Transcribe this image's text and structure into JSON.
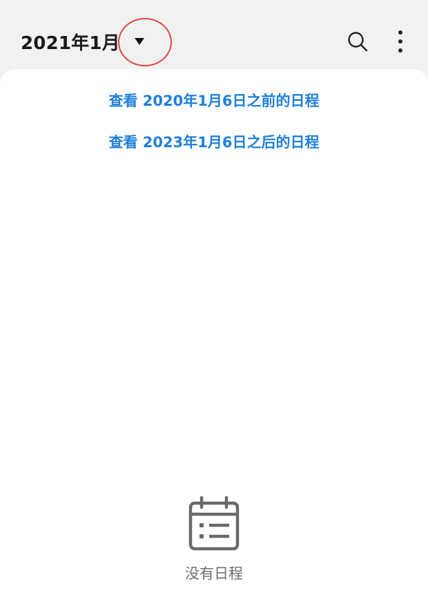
{
  "header": {
    "month_label": "2021年1月"
  },
  "icons": {
    "dropdown": "caret-down-icon",
    "search": "search-icon",
    "more": "more-vertical-icon",
    "empty": "calendar-icon"
  },
  "links": {
    "before": "查看 2020年1月6日之前的日程",
    "after": "查看 2023年1月6日之后的日程"
  },
  "empty_state": {
    "text": "没有日程"
  },
  "colors": {
    "link": "#1f7fdb",
    "highlight_ring": "#e0453f",
    "title": "#1a1a1a",
    "muted": "#6e6e6e"
  }
}
